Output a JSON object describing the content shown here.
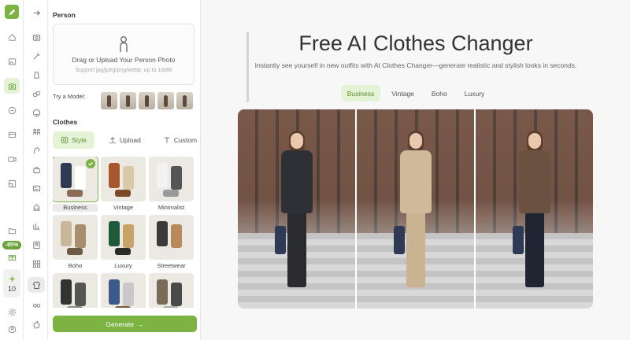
{
  "rail": {
    "promo_badge": "-85%",
    "credits": "10",
    "icons": [
      "home-icon",
      "image-icon",
      "shirt-camera-icon",
      "chat-icon",
      "message-icon",
      "video-icon",
      "gallery-icon",
      "folder-icon",
      "gift-icon",
      "sparkle-icon",
      "settings-icon",
      "user-icon"
    ]
  },
  "panel": {
    "person_title": "Person",
    "upload_text": "Drag or Upload Your Person Photo",
    "upload_hint": "Support jpg/jpeg/png/webp, up to 16MB",
    "try_model_label": "Try a Model:",
    "clothes_title": "Clothes",
    "tabs": [
      {
        "label": "Style",
        "icon": "style-icon"
      },
      {
        "label": "Upload",
        "icon": "upload-icon"
      },
      {
        "label": "Custom",
        "icon": "text-icon"
      }
    ],
    "styles": [
      {
        "label": "Business",
        "selected": true,
        "colors": [
          "#2e3b52",
          "#ffffff",
          "#8a6b55"
        ]
      },
      {
        "label": "Vintage",
        "selected": false,
        "colors": [
          "#a8562e",
          "#d9c9a8",
          "#7a4a2a"
        ]
      },
      {
        "label": "Minimalist",
        "selected": false,
        "colors": [
          "#f2f2f2",
          "#555555",
          "#999999"
        ]
      },
      {
        "label": "Boho",
        "selected": false,
        "colors": [
          "#c9b79a",
          "#a88f6a",
          "#6e5a44"
        ]
      },
      {
        "label": "Luxury",
        "selected": false,
        "colors": [
          "#1f5a3a",
          "#c7a36a",
          "#2a2a2a"
        ]
      },
      {
        "label": "Streetwear",
        "selected": false,
        "colors": [
          "#3a3a3a",
          "#b88a5a",
          "#e8e8e8"
        ]
      },
      {
        "label": "",
        "selected": false,
        "colors": [
          "#333333",
          "#555555",
          "#888888"
        ]
      },
      {
        "label": "",
        "selected": false,
        "colors": [
          "#3b5a8a",
          "#c8c8c8",
          "#7a5a3a"
        ]
      },
      {
        "label": "",
        "selected": false,
        "colors": [
          "#7a6a5a",
          "#4a4a4a",
          "#aaaaaa"
        ]
      }
    ],
    "generate_label": "Generate"
  },
  "main": {
    "title": "Free AI Clothes Changer",
    "subtitle": "Instantly see yourself in new outfits with AI Clothes Changer—generate realistic and stylish looks in seconds.",
    "style_tabs": [
      {
        "label": "Business",
        "active": true
      },
      {
        "label": "Vintage",
        "active": false
      },
      {
        "label": "Boho",
        "active": false
      },
      {
        "label": "Luxury",
        "active": false
      }
    ],
    "photos": [
      {
        "torso": "#2e3035",
        "legs": "#2a2b2e"
      },
      {
        "torso": "#cfb99a",
        "legs": "#c9b391"
      },
      {
        "torso": "#6b5140",
        "legs": "#1f2533"
      }
    ]
  },
  "colors": {
    "accent": "#7cb342",
    "accent_light": "#e4f2d6"
  }
}
